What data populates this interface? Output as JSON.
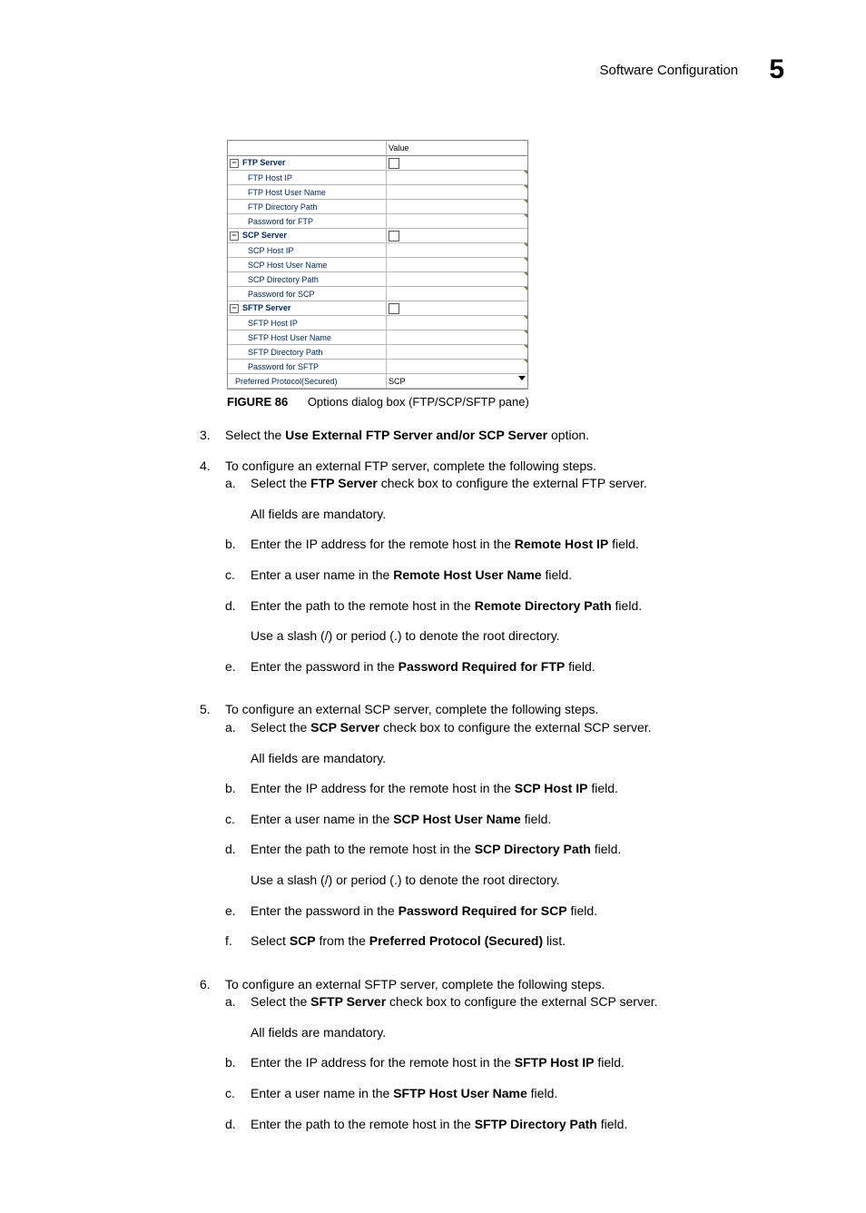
{
  "header": {
    "section": "Software Configuration",
    "chapter": "5"
  },
  "dialog": {
    "header_value": "Value",
    "groups": [
      {
        "name": "FTP Server",
        "checkbox": true,
        "items": [
          "FTP Host IP",
          "FTP Host User Name",
          "FTP Directory Path",
          "Password for FTP"
        ]
      },
      {
        "name": "SCP Server",
        "checkbox": true,
        "items": [
          "SCP Host IP",
          "SCP Host User Name",
          "SCP Directory Path",
          "Password for SCP"
        ]
      },
      {
        "name": "SFTP Server",
        "checkbox": true,
        "items": [
          "SFTP Host IP",
          "SFTP Host User Name",
          "SFTP Directory Path",
          "Password for SFTP"
        ]
      }
    ],
    "protocol_row": {
      "label": "Preferred Protocol(Secured)",
      "value": "SCP"
    }
  },
  "figure": {
    "label": "FIGURE 86",
    "caption": "Options dialog box (FTP/SCP/SFTP pane)"
  },
  "steps": {
    "s3": {
      "n": "3.",
      "pre": "Select the ",
      "bold": "Use External FTP Server and/or SCP Server",
      "post": " option."
    },
    "s4": {
      "n": "4.",
      "text": "To configure an external FTP server, complete the following steps.",
      "a": {
        "n": "a.",
        "pre": "Select the ",
        "bold": "FTP Server",
        "post": " check box to configure the external FTP server.",
        "note": "All fields are mandatory."
      },
      "b": {
        "n": "b.",
        "pre": "Enter the IP address for the remote host in the ",
        "bold": "Remote Host IP",
        "post": " field."
      },
      "c": {
        "n": "c.",
        "pre": "Enter a user name in the ",
        "bold": "Remote Host User Name",
        "post": " field."
      },
      "d": {
        "n": "d.",
        "pre": "Enter the path to the remote host in the ",
        "bold": "Remote Directory Path",
        "post": " field.",
        "note": "Use a slash (/) or period (.) to denote the root directory."
      },
      "e": {
        "n": "e.",
        "pre": "Enter the password in the ",
        "bold": "Password Required for FTP",
        "post": " field."
      }
    },
    "s5": {
      "n": "5.",
      "text": "To configure an external SCP server, complete the following steps.",
      "a": {
        "n": "a.",
        "pre": "Select the ",
        "bold": "SCP Server",
        "post": " check box to configure the external SCP server.",
        "note": "All fields are mandatory."
      },
      "b": {
        "n": "b.",
        "pre": "Enter the IP address for the remote host in the ",
        "bold": "SCP Host IP",
        "post": " field."
      },
      "c": {
        "n": "c.",
        "pre": "Enter a user name in the ",
        "bold": "SCP Host User Name",
        "post": " field."
      },
      "d": {
        "n": "d.",
        "pre": "Enter the path to the remote host in the ",
        "bold": "SCP Directory Path",
        "post": " field.",
        "note": "Use a slash (/) or period (.) to denote the root directory."
      },
      "e": {
        "n": "e.",
        "pre": "Enter the password in the ",
        "bold": "Password Required for SCP",
        "post": " field."
      },
      "f": {
        "n": "f.",
        "pre": "Select ",
        "bold": "SCP",
        "mid": " from the ",
        "bold2": "Preferred Protocol (Secured)",
        "post": " list."
      }
    },
    "s6": {
      "n": "6.",
      "text": "To configure an external SFTP server, complete the following steps.",
      "a": {
        "n": "a.",
        "pre": "Select the ",
        "bold": "SFTP Server",
        "post": " check box to configure the external SCP server.",
        "note": "All fields are mandatory."
      },
      "b": {
        "n": "b.",
        "pre": "Enter the IP address for the remote host in the ",
        "bold": "SFTP Host IP",
        "post": " field."
      },
      "c": {
        "n": "c.",
        "pre": "Enter a user name in the ",
        "bold": "SFTP Host User Name",
        "post": " field."
      },
      "d": {
        "n": "d.",
        "pre": "Enter the path to the remote host in the ",
        "bold": "SFTP Directory Path",
        "post": " field."
      }
    }
  }
}
